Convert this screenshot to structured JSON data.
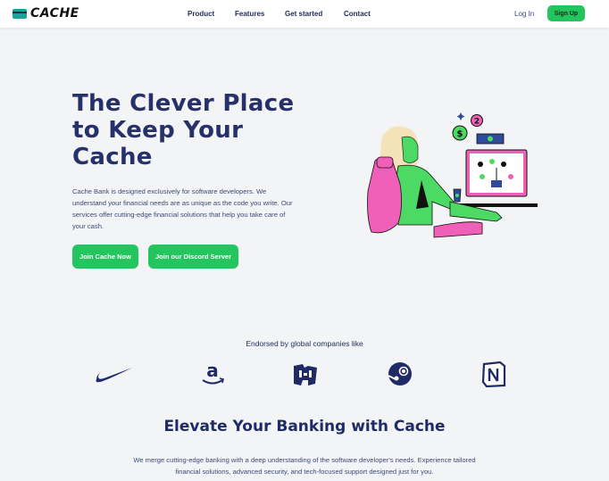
{
  "brand": {
    "name": "CACHE",
    "icon": "credit-card-icon"
  },
  "nav": {
    "links": [
      "Product",
      "Features",
      "Get started",
      "Contact"
    ],
    "login": "Log In",
    "signup": "Sign Up"
  },
  "hero": {
    "title_lines": [
      "The Clever Place",
      "to Keep Your",
      "Cache"
    ],
    "description": "Cache Bank is designed exclusively for software developers. We understand your financial needs are as unique as the code you write. Our services offer cutting-edge financial solutions that help you take care of your cash.",
    "primary_button": "Join Cache Now",
    "secondary_button": "Join our Discord Server"
  },
  "endorsed": {
    "heading": "Endorsed by global companies like",
    "logos": [
      "nike-logo-icon",
      "amazon-logo-icon",
      "minecraft-logo-icon",
      "steam-logo-icon",
      "notion-logo-icon"
    ]
  },
  "features": {
    "title": "Elevate Your Banking with Cache",
    "description": "We merge cutting-edge banking with a deep understanding of the software developer's needs. Experience tailored financial solutions, advanced security, and tech-focused support designed just for you."
  },
  "colors": {
    "accent": "#22c55e",
    "heading": "#26316a",
    "background": "#f3f4f6",
    "illustration_pink": "#f05fb8",
    "illustration_green": "#4cd964"
  }
}
